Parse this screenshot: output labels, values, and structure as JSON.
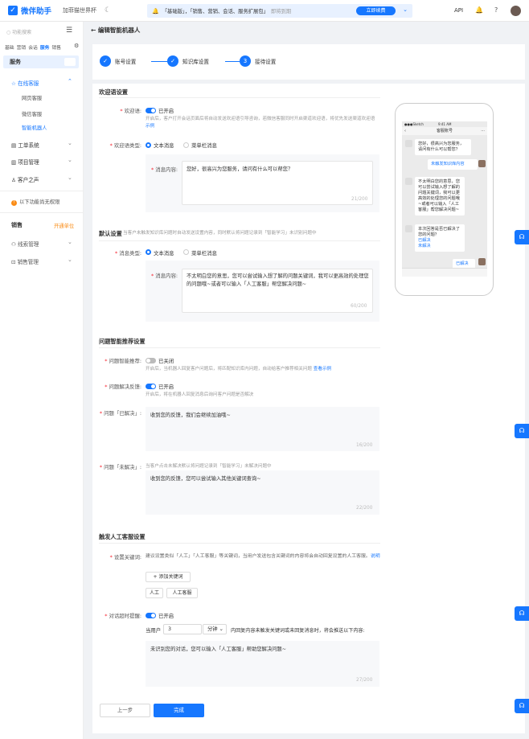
{
  "topbar": {
    "logo_text": "微伴助手",
    "company": "加菲猫世界杯",
    "notice": {
      "prefix": "「基础版」，「销售、营销、会话、服务扩展包」",
      "hint": "即将到期",
      "button": "立即续费"
    },
    "api": "API"
  },
  "sidebar": {
    "search_placeholder": "功能搜索",
    "tabs": [
      "基础",
      "营销",
      "会话",
      "服务",
      "销售"
    ],
    "active_tab": "服务",
    "section": "服务",
    "group_online": "在线客服",
    "sub_items": [
      "网页客服",
      "微信客服",
      "智能机器人"
    ],
    "groups": [
      "工单系统",
      "项目管理",
      "客户之声"
    ],
    "warning": "以下功能尚无权限",
    "sales": "销售",
    "sales_open": "开通单位",
    "sales_items": [
      "线索管理",
      "销售管理"
    ]
  },
  "page": {
    "breadcrumb": "编辑智能机器人",
    "steps": [
      {
        "num": "✓",
        "label": "账号设置"
      },
      {
        "num": "✓",
        "label": "知识库设置"
      },
      {
        "num": "3",
        "label": "接待设置"
      }
    ]
  },
  "welcome": {
    "title": "欢迎语设置",
    "switch_label": "欢迎语",
    "switch_state": "已开启",
    "desc": "开启后，客户打开会话页面后将自动发送欢迎语引导咨询，若微信客服同时开启渠道欢迎语，将优先发送渠道欢迎语",
    "desc_link": "示例",
    "type_label": "欢迎语类型",
    "type_text": "文本消息",
    "type_menu": "菜单栏消息",
    "content_label": "消息内容",
    "content": "您好，很高兴为您服务，请问有什么可以帮您？",
    "counter": "21/200"
  },
  "default": {
    "title": "默认设置",
    "desc": "当客户未触发知识库问题时自动发送设置内容，同时默认将问题记录到「智能学习」未识别问题中",
    "type_label": "消息类型",
    "type_text": "文本消息",
    "type_menu": "菜单栏消息",
    "content_label": "消息内容",
    "content": "不太明白您的意思，您可以尝试输入想了解的问题关键词，我可以更高效的处理您的问题哦~或者可以输入「人工客服」帮您解决问题~",
    "counter": "60/200"
  },
  "recommend": {
    "title": "问题智能推荐设置",
    "smart_label": "问题智能推荐",
    "smart_state": "已关闭",
    "smart_desc": "开启后，当机器人回复客户问题后，将匹配知识库内问题，自动给客户推荐相关问题",
    "smart_link": "查看示例",
    "feedback_label": "问题解决反馈",
    "feedback_state": "已开启",
    "feedback_desc": "开启后，将在机器人回复消息后询问客户问题是否解决",
    "solved_label": "问题「已解决」",
    "solved_text": "收到您的反馈，我们会继续加油哦~",
    "solved_counter": "16/200",
    "unsolved_label": "问题「未解决」",
    "unsolved_desc": "当客户点击未解决默认将问题记录到「智能学习」未解决问题中",
    "unsolved_text": "收到您的反馈，您可以尝试输入其他关键词查询~",
    "unsolved_counter": "22/200"
  },
  "human": {
    "title": "触发人工客服设置",
    "keyword_label": "设置关键词",
    "keyword_desc": "建议设置类似「人工」「人工客服」等关键词，当用户发送包含关键词的内容将会自动回复设置的人工客服。",
    "keyword_link": "说明",
    "add_button": "+ 添加关键词",
    "tags": [
      "人工",
      "人工客服"
    ],
    "timeout_label": "对话超时提醒",
    "timeout_state": "已开启",
    "when": "当用户",
    "minutes": "3",
    "unit": "分钟",
    "timeout_desc": "内回复内容未触发关键词或未回复消息时，将会推送以下内容:",
    "timeout_text": "未识别您的对话，您可以输入「人工客服」帮助您解决问题~",
    "timeout_counter": "27/200"
  },
  "buttons": {
    "prev": "上一步",
    "done": "完成"
  },
  "phone": {
    "status_left": "●●●Sketch",
    "status_time": "9:41 AM",
    "title": "客服账号",
    "msg1": "您好，很高兴为您服务，请问有什么可以帮您？",
    "msg2": "未触发知识库内容",
    "msg3": "不太明白您的意思，您可以尝试输入想了解的问题关键词，我可以更高效的处理您的问题哦~或者可以输入「人工客服」帮您解决问题~",
    "msg4": "本次回答是否已解决了您的问题？",
    "msg4_yes": "已解决",
    "msg4_no": "未解决",
    "msg5": "已解决"
  }
}
